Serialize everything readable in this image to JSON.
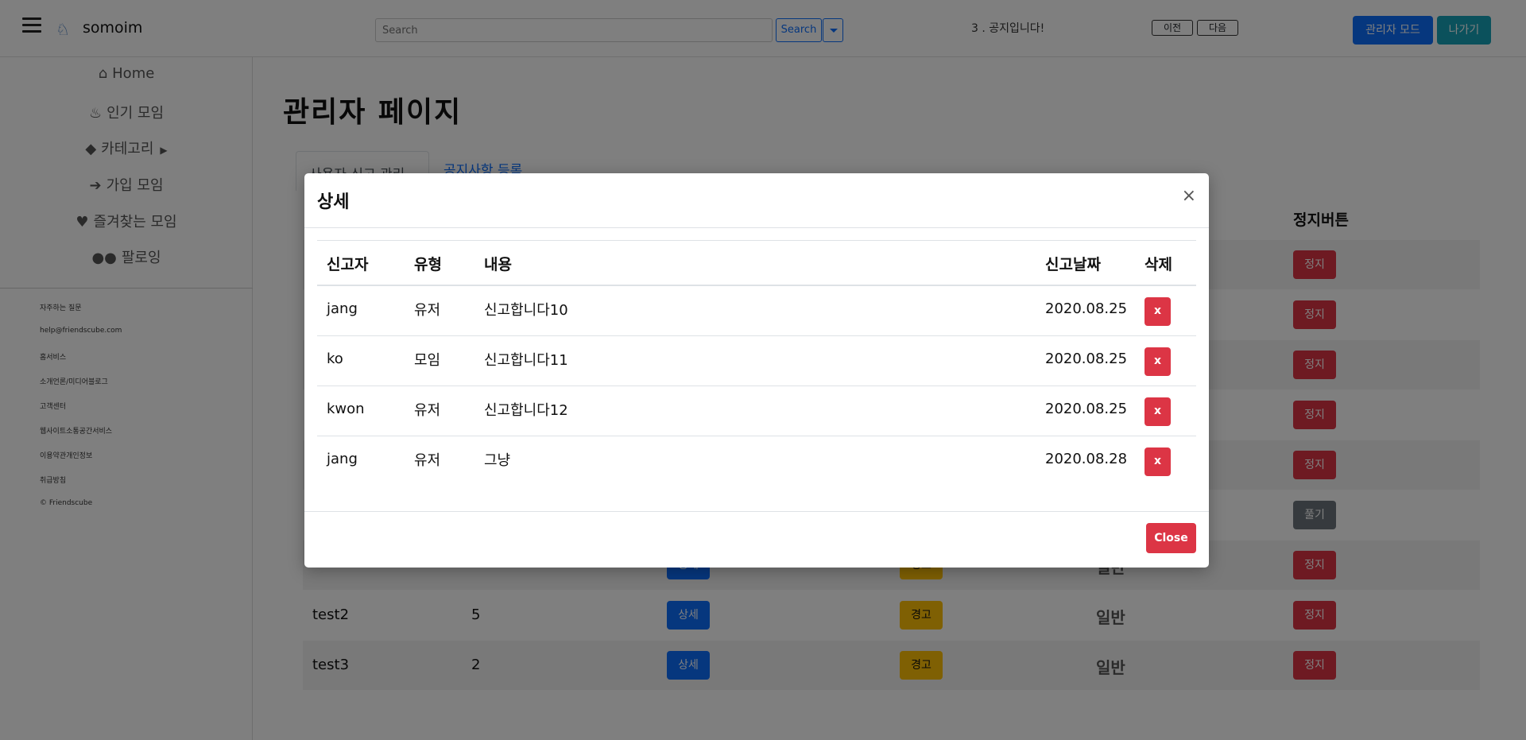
{
  "navbar": {
    "brand": "somoim",
    "search_placeholder": "Search",
    "search_label": "Search",
    "notice": "3 . 공지입니다!",
    "prev_label": "이전",
    "next_label": "다음",
    "admin_mode_label": "관리자 모드",
    "exit_label": "나가기"
  },
  "sidebar": {
    "items": [
      {
        "label": "Home",
        "icon": "home-icon"
      },
      {
        "label": "인기 모임",
        "icon": "fire-icon"
      },
      {
        "label": "카테고리",
        "icon": "tags-icon"
      },
      {
        "label": "가입 모임",
        "icon": "sign-in-icon"
      },
      {
        "label": "즐겨찾는 모임",
        "icon": "heart-icon"
      },
      {
        "label": "팔로잉",
        "icon": "users-icon"
      }
    ],
    "footer_links": [
      "자주하는 질문",
      "help@friendscube.com",
      "홈서비스",
      "소개언론/미디어블로그",
      "고객센터",
      "웹사이트소통공간서비스",
      "이용약관개인정보",
      "취급방침",
      "© Friendscube"
    ]
  },
  "main": {
    "title": "관리자 페이지",
    "tab_active": "사용자 신고 관리",
    "tab_notice": "공지사항 등록",
    "stop_header": "정지버튼",
    "rows": [
      {
        "uid": "",
        "count": "",
        "detail": "",
        "warn": "",
        "grade": "",
        "stop": "정지"
      },
      {
        "uid": "",
        "count": "",
        "detail": "",
        "warn": "",
        "grade": "",
        "stop": "정지"
      },
      {
        "uid": "",
        "count": "",
        "detail": "",
        "warn": "",
        "grade": "",
        "stop": "정지"
      },
      {
        "uid": "",
        "count": "",
        "detail": "",
        "warn": "",
        "grade": "",
        "stop": "정지"
      },
      {
        "uid": "",
        "count": "",
        "detail": "",
        "warn": "",
        "grade": "",
        "stop": "정지"
      },
      {
        "uid": "",
        "count": "",
        "detail": "",
        "warn": "",
        "grade": "",
        "stop": "풀기"
      },
      {
        "uid": "",
        "count": "",
        "detail": "상세",
        "warn": "경고",
        "grade": "일반",
        "stop": "정지"
      },
      {
        "uid": "test2",
        "count": "5",
        "detail": "상세",
        "warn": "경고",
        "grade": "일반",
        "stop": "정지"
      },
      {
        "uid": "test3",
        "count": "2",
        "detail": "상세",
        "warn": "경고",
        "grade": "일반",
        "stop": "정지"
      }
    ]
  },
  "modal": {
    "title": "상세",
    "close_x": "×",
    "close_label": "Close",
    "headers": [
      "신고자",
      "유형",
      "내용",
      "신고날짜",
      "삭제"
    ],
    "rows": [
      {
        "reporter": "jang",
        "type": "유저",
        "content": "신고합니다10",
        "date": "2020.08.25",
        "delete": "x"
      },
      {
        "reporter": "ko",
        "type": "모임",
        "content": "신고합니다11",
        "date": "2020.08.25",
        "delete": "x"
      },
      {
        "reporter": "kwon",
        "type": "유저",
        "content": "신고합니다12",
        "date": "2020.08.25",
        "delete": "x"
      },
      {
        "reporter": "jang",
        "type": "유저",
        "content": "그냥",
        "date": "2020.08.28",
        "delete": "x"
      }
    ]
  },
  "colors": {
    "primary": "#0d6efd",
    "danger": "#dc3545",
    "warning": "#ffc107",
    "info": "#17a2b8",
    "secondary": "#6c757d"
  }
}
